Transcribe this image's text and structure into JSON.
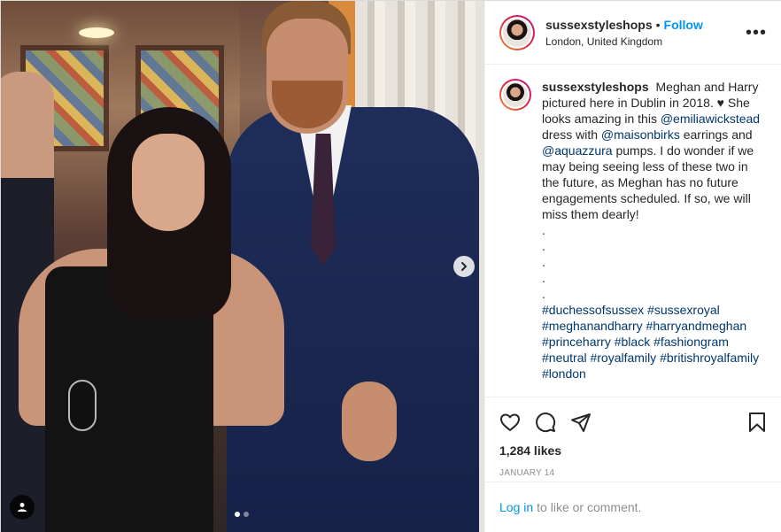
{
  "header": {
    "username": "sussexstyleshops",
    "bullet": "•",
    "follow_label": "Follow",
    "location": "London, United Kingdom",
    "more_label": "•••"
  },
  "caption": {
    "username": "sussexstyleshops",
    "text1": "Meghan and Harry pictured here in Dublin in 2018. ♥ She looks amazing in this",
    "mention1": "@emiliawickstead",
    "text2": "dress with",
    "mention2": "@maisonbirks",
    "text3": "earrings and",
    "mention3": "@aquazzura",
    "text4": "pumps. I do wonder if we may being seeing less of these two in the future, as Meghan has no future engagements scheduled. If so, we will miss them dearly!",
    "dots": [
      ".",
      ".",
      ".",
      ".",
      "."
    ],
    "hashtags": [
      "#duchessofsussex",
      "#sussexroyal",
      "#meghanandharry",
      "#harryandmeghan",
      "#princeharry",
      "#black",
      "#fashiongram",
      "#neutral",
      "#royalfamily",
      "#britishroyalfamily",
      "#london"
    ]
  },
  "stats": {
    "likes": "1,284 likes",
    "date": "January 14"
  },
  "login_bar": {
    "link": "Log in",
    "text": "to like or comment."
  },
  "carousel": {
    "current": 1,
    "total": 2
  },
  "icons": {
    "like": "heart-icon",
    "comment": "comment-icon",
    "share": "share-icon",
    "save": "bookmark-icon",
    "next": "chevron-right-icon",
    "tag": "user-tag-icon"
  },
  "colors": {
    "accent": "#0095f6",
    "link": "#00376b",
    "muted": "#8e8e8e"
  }
}
